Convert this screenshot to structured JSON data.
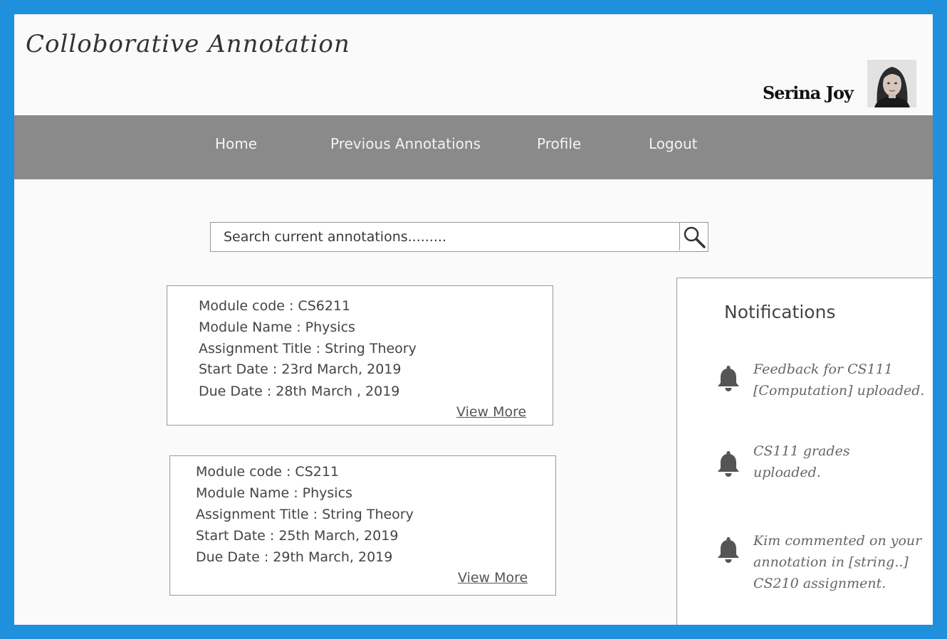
{
  "app": {
    "title": "Colloborative Annotation"
  },
  "user": {
    "name": "Serina Joy"
  },
  "nav": {
    "items": [
      {
        "label": "Home"
      },
      {
        "label": "Previous Annotations"
      },
      {
        "label": "Profile"
      },
      {
        "label": "Logout"
      }
    ]
  },
  "search": {
    "placeholder": "Search current annotations.........",
    "value": ""
  },
  "cards": [
    {
      "lines": [
        "Module code : CS6211",
        "Module Name :  Physics",
        "Assignment Title : String Theory",
        "Start Date : 23rd March, 2019",
        "Due Date : 28th March , 2019"
      ],
      "link": "View More"
    },
    {
      "lines": [
        "Module code : CS211",
        "Module Name : Physics",
        "Assignment Title : String Theory",
        "Start Date : 25th March, 2019",
        "Due Date : 29th March, 2019"
      ],
      "link": "View More"
    }
  ],
  "notifications": {
    "title": "Notifications",
    "items": [
      {
        "lines": [
          "Feedback for CS111",
          "[Computation] uploaded."
        ]
      },
      {
        "lines": [
          "CS111 grades",
          "uploaded."
        ]
      },
      {
        "lines": [
          "Kim commented on your",
          "annotation in [string..]",
          "CS210 assignment."
        ]
      }
    ]
  },
  "colors": {
    "frame": "#1e90dc",
    "navbar": "#8a8a8a",
    "background": "#fafafa"
  },
  "icons": {
    "search": "search-icon",
    "bell": "bell-icon",
    "avatar": "user-photo"
  }
}
